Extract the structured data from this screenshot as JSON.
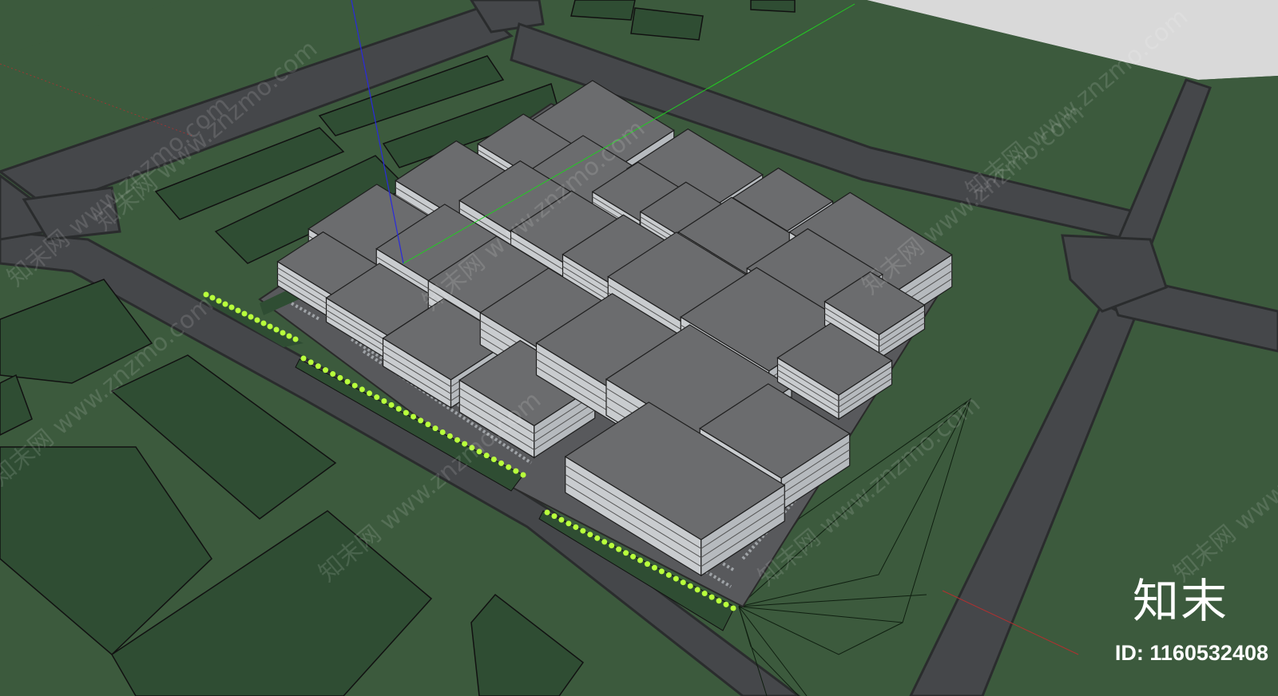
{
  "scene": {
    "ground_color": "#3c5a3d",
    "road_color": "#454749",
    "roof_color": "#6b6c6e",
    "wall_color": "#c9cccf",
    "tree_color": "#b8ff3c",
    "axis_colors": {
      "blue": "#2a2adc",
      "green": "#22cc22",
      "red": "#b03030"
    }
  },
  "watermarks": [
    "知末网 www.znzmo.com",
    "知末网 www.znzmo.com",
    "知末网 www.znzmo.com",
    "知末网 www.znzmo.com",
    "知末网 www.znzmo.com",
    "知末网 www.znzmo.com",
    "知末网 www.znzmo.com",
    "知末网 www.znzmo.com",
    "知末网 www.znzmo.com"
  ],
  "logo": {
    "text": "知末"
  },
  "image_id": {
    "label": "ID: 1160532408"
  }
}
